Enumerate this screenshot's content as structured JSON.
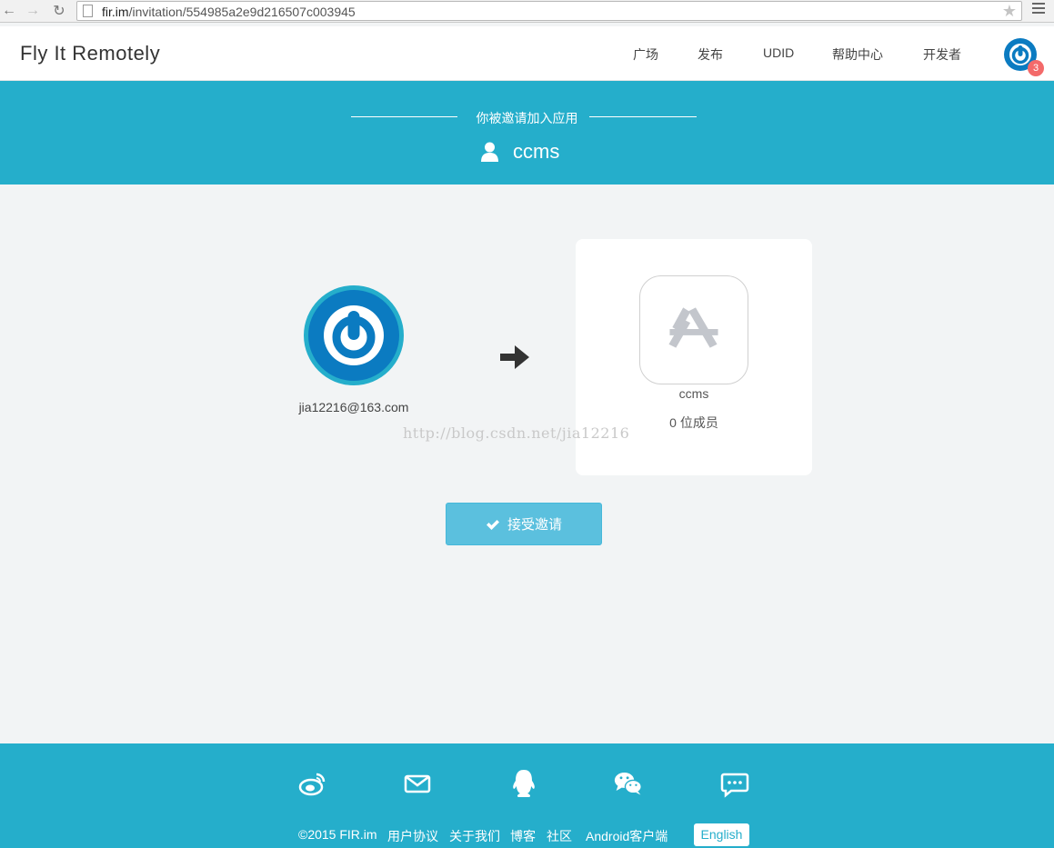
{
  "browser": {
    "url_host": "fir.im",
    "url_path": "/invitation/554985a2e9d216507c003945"
  },
  "header": {
    "brand": "Fly It Remotely",
    "nav": [
      "广场",
      "发布",
      "UDID",
      "帮助中心",
      "开发者"
    ],
    "notification_count": "3"
  },
  "banner": {
    "subtitle": "你被邀请加入应用",
    "app_title": "ccms"
  },
  "invite": {
    "inviter_email": "jia12216@163.com",
    "app_name": "ccms",
    "members": "0 位成员",
    "accept_label": "接受邀请"
  },
  "watermark": "http://blog.csdn.net/jia12216",
  "footer": {
    "copyright": "©2015 FIR.im",
    "links": [
      "用户协议",
      "关于我们",
      "博客",
      "社区",
      "Android客户端"
    ],
    "language_button": "English",
    "social_icons": [
      "weibo-icon",
      "mail-icon",
      "qq-icon",
      "wechat-icon",
      "chat-icon"
    ]
  },
  "colors": {
    "brand_cyan": "#25aecb",
    "button_blue": "#5bc0de",
    "logo_blue": "#0b7bc1",
    "badge_red": "#f36a6a"
  }
}
